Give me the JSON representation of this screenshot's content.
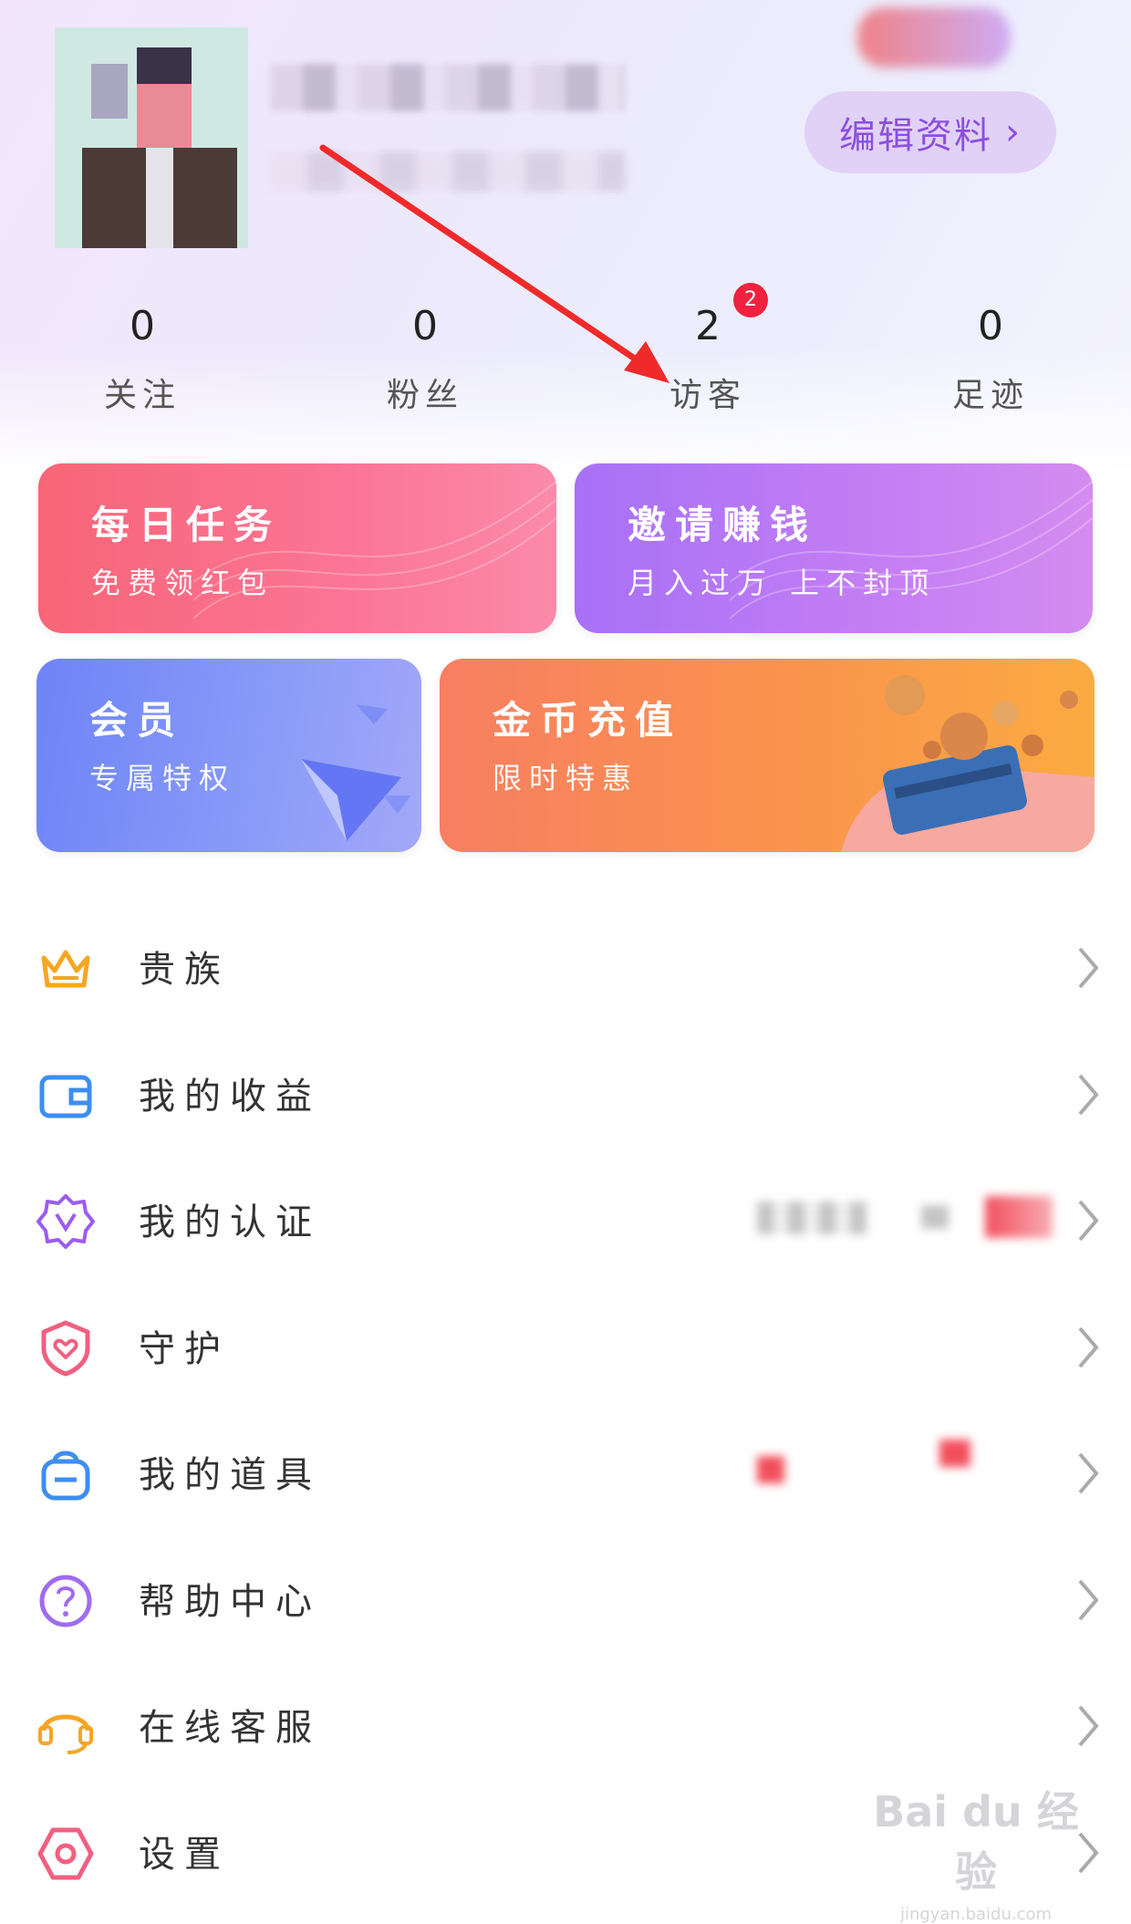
{
  "profile": {
    "edit_label": "编辑资料",
    "edit_chevron": "›"
  },
  "stats": [
    {
      "value": "0",
      "label": "关注"
    },
    {
      "value": "0",
      "label": "粉丝"
    },
    {
      "value": "2",
      "label": "访客",
      "badge": "2"
    },
    {
      "value": "0",
      "label": "足迹"
    }
  ],
  "cards": [
    {
      "title": "每日任务",
      "subtitle": "免费领红包"
    },
    {
      "title": "邀请赚钱",
      "subtitle": "月入过万 上不封顶"
    },
    {
      "title": "会员",
      "subtitle": "专属特权"
    },
    {
      "title": "金币充值",
      "subtitle": "限时特惠"
    }
  ],
  "menu": [
    {
      "label": "贵族",
      "icon": "crown-icon"
    },
    {
      "label": "我的收益",
      "icon": "wallet-icon"
    },
    {
      "label": "我的认证",
      "icon": "verified-badge-icon"
    },
    {
      "label": "守护",
      "icon": "shield-heart-icon"
    },
    {
      "label": "我的道具",
      "icon": "backpack-icon"
    },
    {
      "label": "帮助中心",
      "icon": "help-icon"
    },
    {
      "label": "在线客服",
      "icon": "headset-icon"
    },
    {
      "label": "设置",
      "icon": "settings-icon"
    }
  ],
  "watermark": {
    "line1": "Bai du 经验",
    "line2": "jingyan.baidu.com"
  },
  "colors": {
    "accent": "#8b4fe0",
    "badge": "#f0223f",
    "annotation_arrow": "#f02a2a"
  }
}
